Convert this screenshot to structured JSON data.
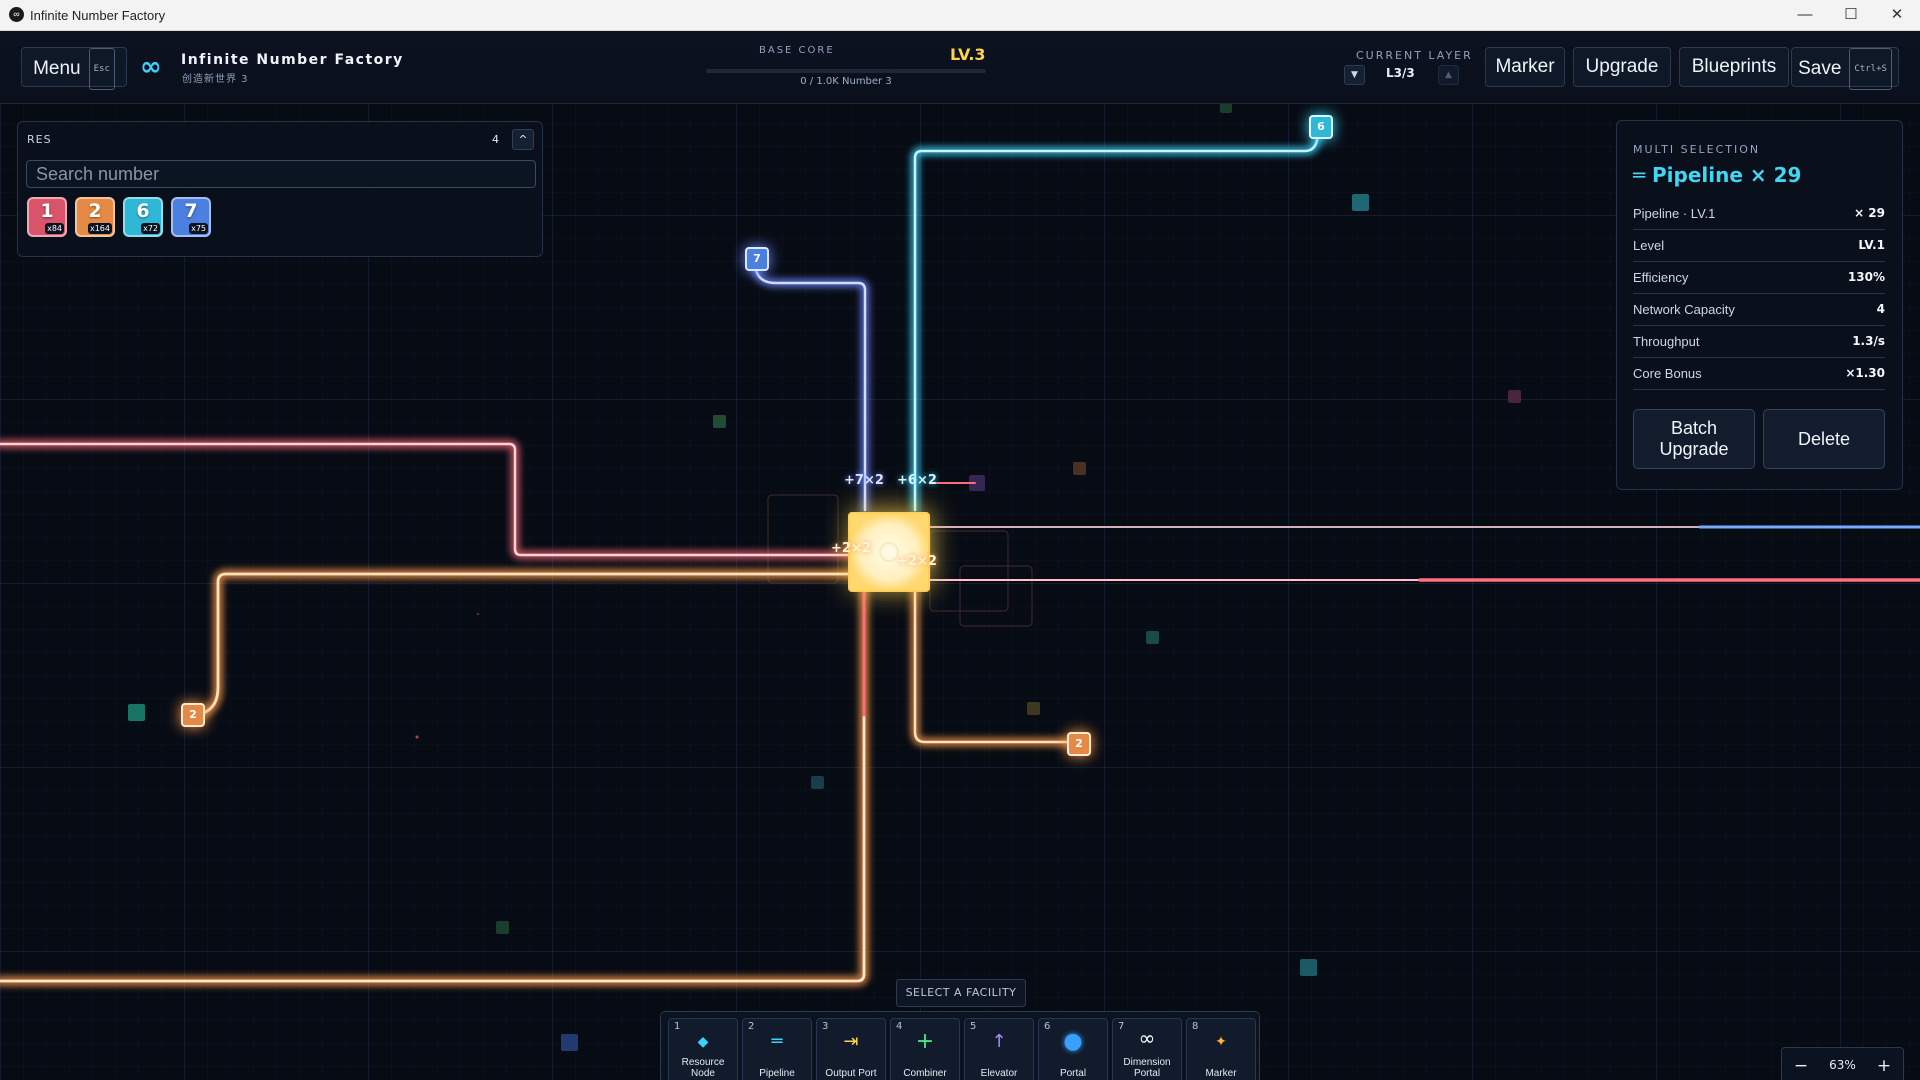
{
  "window": {
    "title": "Infinite Number Factory",
    "minimize": "—",
    "maximize": "☐",
    "close": "✕"
  },
  "header": {
    "menu_label": "Menu",
    "menu_key": "Esc",
    "app_name": "Infinite Number Factory",
    "world_name": "创造新世界 3",
    "base_core_label": "BASE CORE",
    "base_core_level": "LV.3",
    "base_core_progress": "0 / 1.0K Number 3",
    "current_layer_label": "CURRENT LAYER",
    "layer_value": "L3/3",
    "marker_label": "Marker",
    "upgrade_label": "Upgrade",
    "blueprints_label": "Blueprints",
    "save_label": "Save",
    "save_key": "Ctrl+S"
  },
  "resources": {
    "label": "RES",
    "count": "4",
    "collapse": "^",
    "search_placeholder": "Search number",
    "items": [
      {
        "number": "1",
        "count": "x84",
        "color": "#d9546a"
      },
      {
        "number": "2",
        "count": "x164",
        "color": "#e58a44"
      },
      {
        "number": "6",
        "count": "x72",
        "color": "#2fb8d6"
      },
      {
        "number": "7",
        "count": "x75",
        "color": "#4b7fe0"
      }
    ]
  },
  "selection": {
    "label": "MULTI SELECTION",
    "title": "═ Pipeline × 29",
    "rows": [
      {
        "key": "Pipeline · LV.1",
        "value": "× 29"
      },
      {
        "key": "Level",
        "value": "LV.1"
      },
      {
        "key": "Efficiency",
        "value": "130%"
      },
      {
        "key": "Network Capacity",
        "value": "4"
      },
      {
        "key": "Throughput",
        "value": "1.3/s"
      },
      {
        "key": "Core Bonus",
        "value": "×1.30"
      }
    ],
    "batch_upgrade": "Batch Upgrade",
    "delete": "Delete"
  },
  "map": {
    "core_labels": {
      "top_left": "+7×2",
      "top_right": "+6×2",
      "left": "+2×2",
      "right": "+2×2"
    },
    "nodes": [
      {
        "number": "6",
        "color": "#2fb8d6"
      },
      {
        "number": "7",
        "color": "#4b7fe0"
      },
      {
        "number": "2",
        "color": "#e58a44"
      },
      {
        "number": "2",
        "color": "#e58a44"
      }
    ]
  },
  "toolbar": {
    "hint": "SELECT A FACILITY",
    "tools": [
      {
        "key": "1",
        "label": "Resource Node",
        "icon": "◆",
        "icon_name": "resource-node-icon",
        "color": "#39d3ff"
      },
      {
        "key": "2",
        "label": "Pipeline",
        "icon": "═",
        "icon_name": "pipeline-icon",
        "color": "#39d3ff"
      },
      {
        "key": "3",
        "label": "Output Port",
        "icon": "⇥",
        "icon_name": "output-port-icon",
        "color": "#ffd24d"
      },
      {
        "key": "4",
        "label": "Combiner",
        "icon": "+",
        "icon_name": "combiner-icon",
        "color": "#4be38a"
      },
      {
        "key": "5",
        "label": "Elevator",
        "icon": "↑",
        "icon_name": "elevator-icon",
        "color": "#a98bff"
      },
      {
        "key": "6",
        "label": "Portal",
        "icon": "●",
        "icon_name": "portal-icon",
        "color": "#3aa0ff"
      },
      {
        "key": "7",
        "label": "Dimension Portal",
        "icon": "∞",
        "icon_name": "dimension-portal-icon",
        "color": "#ffffff"
      },
      {
        "key": "8",
        "label": "Marker",
        "icon": "✦",
        "icon_name": "marker-icon",
        "color": "#ffb13a"
      }
    ]
  },
  "zoom": {
    "minus": "−",
    "value": "63%",
    "plus": "+"
  }
}
